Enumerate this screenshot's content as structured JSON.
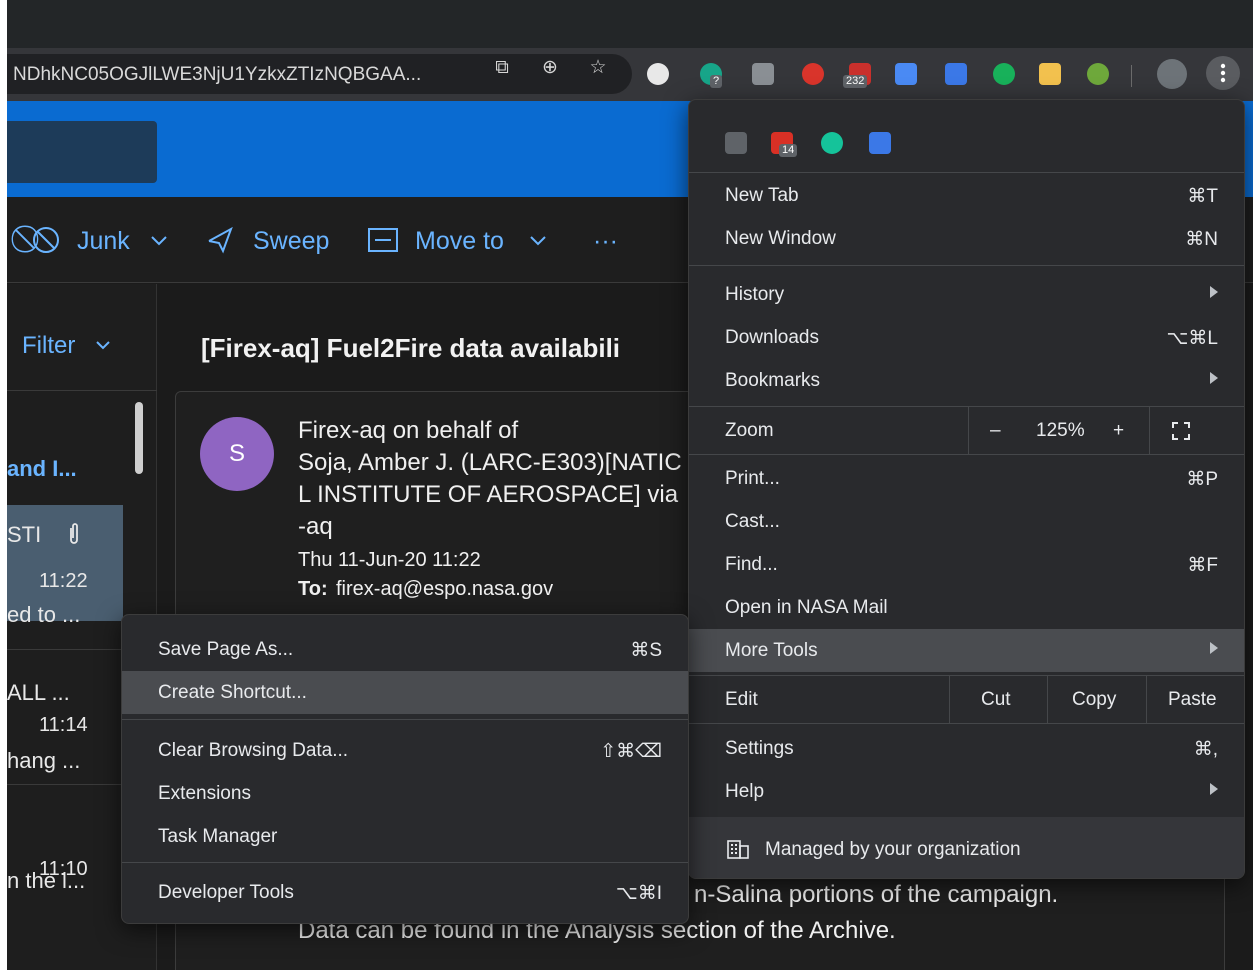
{
  "browser": {
    "url": "NDhkNC05OGJlLWE3NjU1YzkxZTIzNQBGAA...",
    "extension_badges": {
      "help": "?",
      "abp": "232"
    }
  },
  "outlook": {
    "commands": {
      "junk": "Junk",
      "sweep": "Sweep",
      "move_to": "Move to",
      "more": "···"
    },
    "filter_label": "Filter",
    "list_items": [
      {
        "line1": "and I..."
      },
      {
        "line1": "STI",
        "time": "11:22",
        "line2": "ed to ..."
      },
      {
        "line1": "ALL ...",
        "time": "11:14",
        "line2": "hang ..."
      },
      {
        "time": "11:10",
        "line2": "n the l..."
      }
    ],
    "message": {
      "subject": "[Firex-aq] Fuel2Fire data availabili",
      "avatar_letter": "S",
      "from_line1": "Firex-aq on behalf of",
      "from_line2": "Soja, Amber J. (LARC-E303)[NATIC",
      "from_line3": "L INSTITUTE OF AEROSPACE] via",
      "from_line4": "-aq",
      "date": "Thu 11-Jun-20 11:22",
      "to_label": "To:",
      "to_value": "firex-aq@espo.nasa.gov",
      "body_line1": "n-Salina portions of the campaign.",
      "body_line2": "Data can be found in the Analysis section of the Archive."
    }
  },
  "chrome_menu": {
    "ext_badge": "14",
    "new_tab": {
      "label": "New Tab",
      "shortcut": "⌘T"
    },
    "new_window": {
      "label": "New Window",
      "shortcut": "⌘N"
    },
    "history": "History",
    "downloads": {
      "label": "Downloads",
      "shortcut": "⌥⌘L"
    },
    "bookmarks": "Bookmarks",
    "zoom": {
      "label": "Zoom",
      "minus": "–",
      "value": "125%",
      "plus": "+"
    },
    "print": {
      "label": "Print...",
      "shortcut": "⌘P"
    },
    "cast": "Cast...",
    "find": {
      "label": "Find...",
      "shortcut": "⌘F"
    },
    "open_in": "Open in NASA Mail",
    "more_tools": "More Tools",
    "edit": {
      "label": "Edit",
      "cut": "Cut",
      "copy": "Copy",
      "paste": "Paste"
    },
    "settings": {
      "label": "Settings",
      "shortcut": "⌘,"
    },
    "help": "Help",
    "managed": "Managed by your organization"
  },
  "submenu": {
    "save_page": {
      "label": "Save Page As...",
      "shortcut": "⌘S"
    },
    "create_shortcut": "Create Shortcut...",
    "clear_data": {
      "label": "Clear Browsing Data...",
      "shortcut": "⇧⌘⌫"
    },
    "extensions": "Extensions",
    "task_manager": "Task Manager",
    "dev_tools": {
      "label": "Developer Tools",
      "shortcut": "⌥⌘I"
    }
  },
  "colors": {
    "outlook_blue": "#0a6bd1",
    "link_blue": "#6ab4ff",
    "menu_bg": "#292a2d",
    "menu_highlight": "#4a4c50",
    "avatar": "#8f65c2"
  }
}
